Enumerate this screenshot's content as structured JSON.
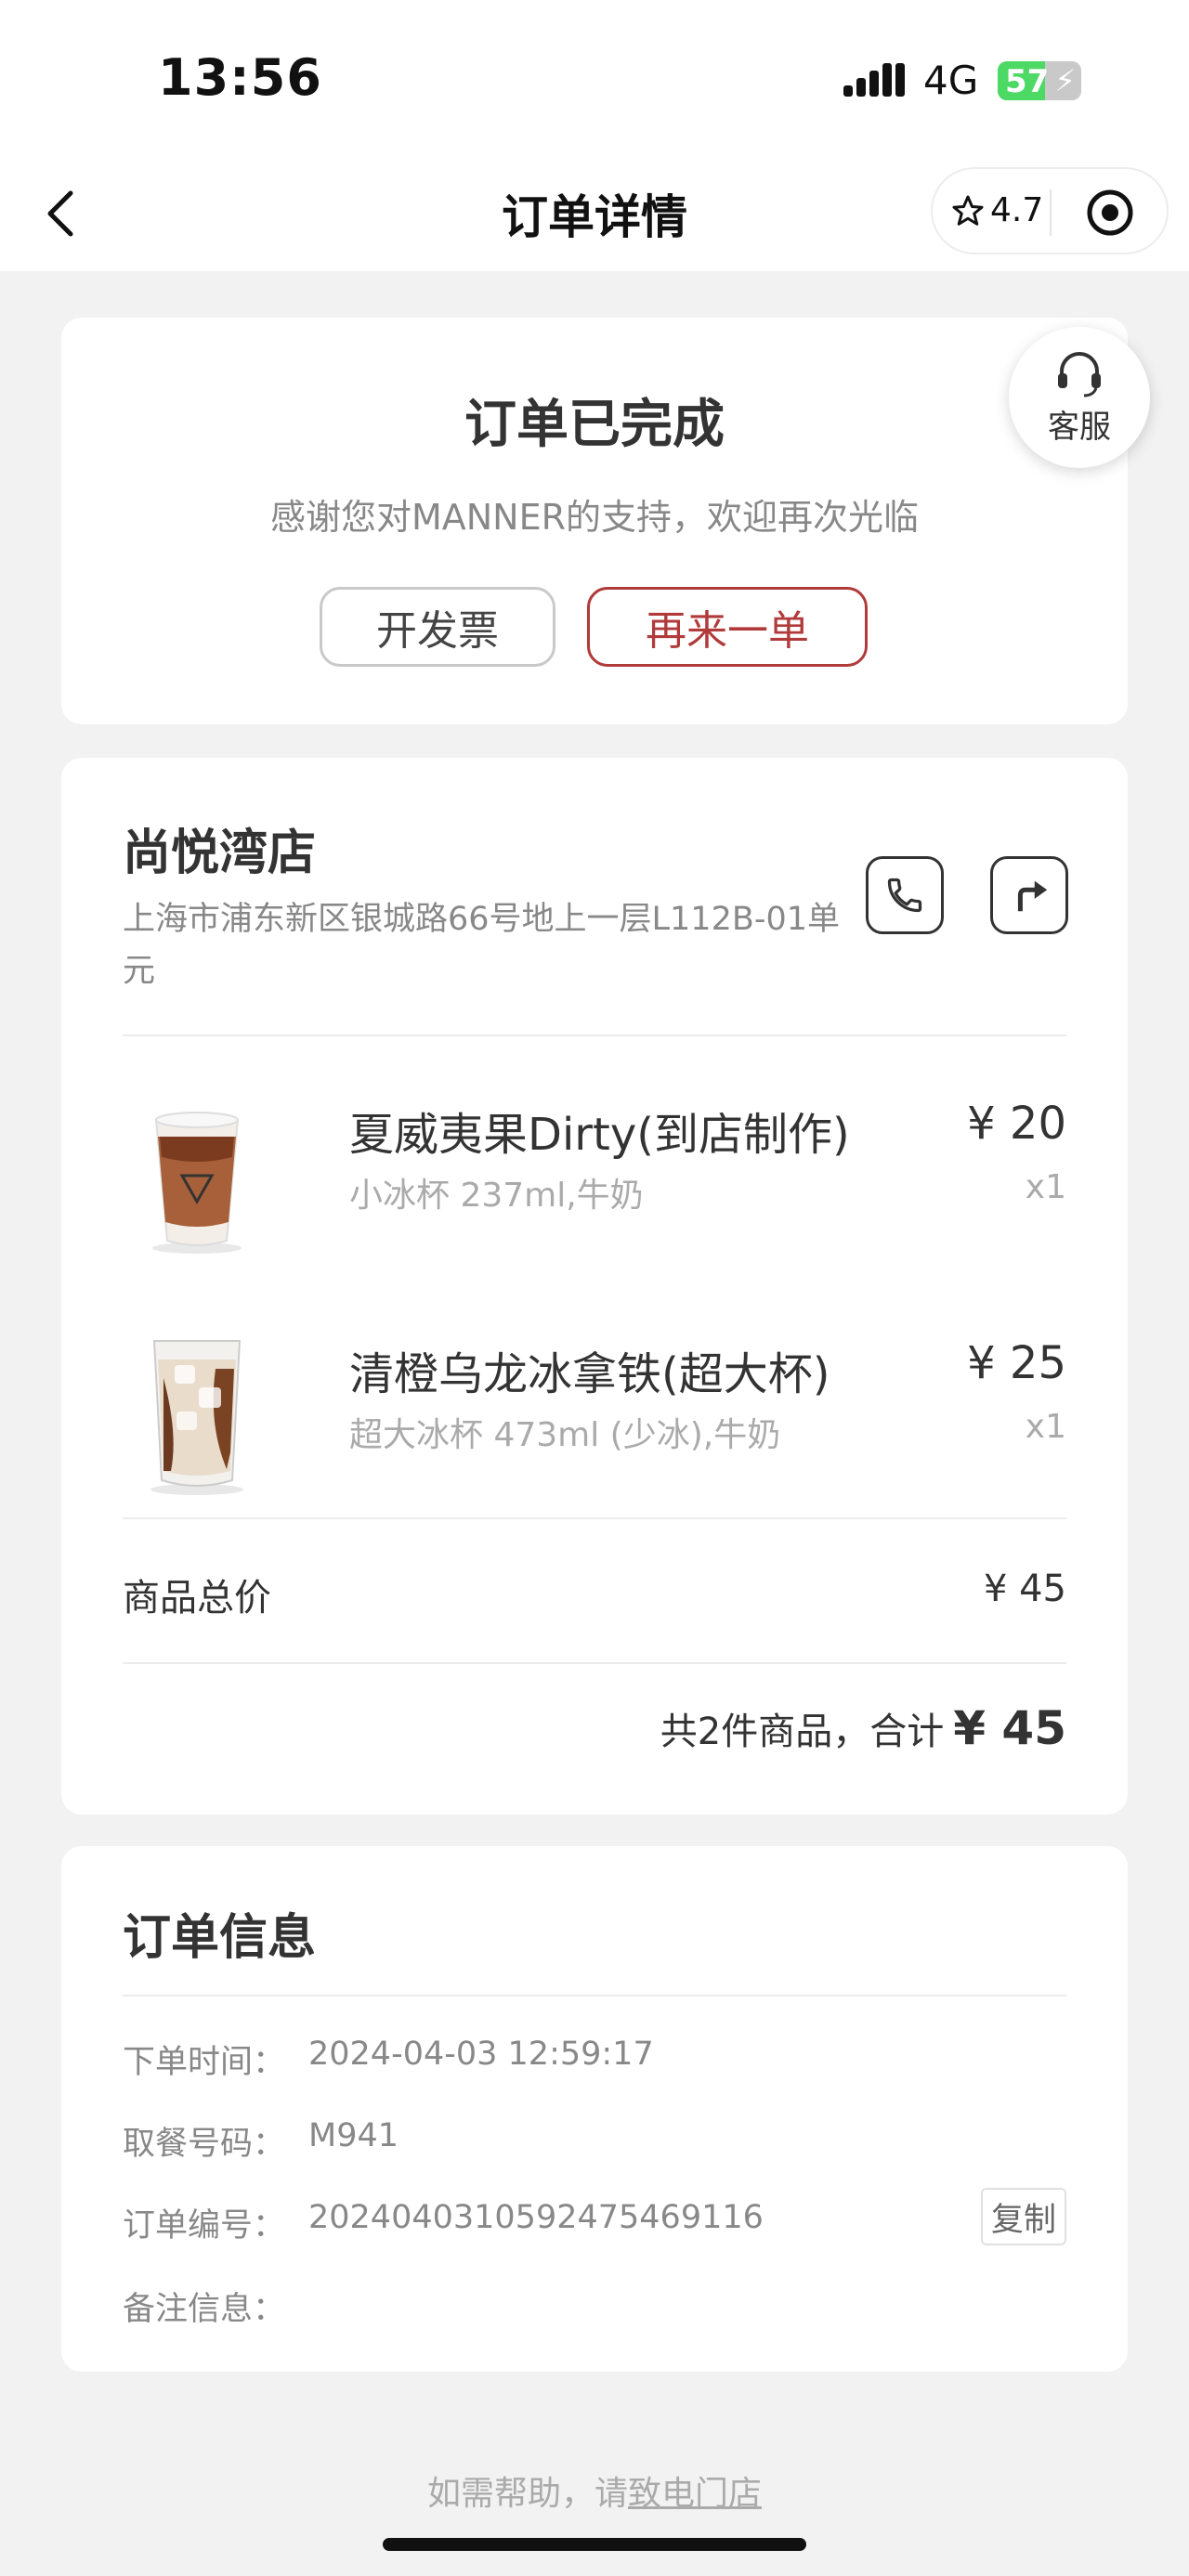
{
  "status_bar": {
    "time": "13:56",
    "network": "4G",
    "battery_level": "57",
    "battery_percent": 57,
    "battery_color": "#4cd964"
  },
  "nav": {
    "title": "订单详情",
    "rating": "4.7",
    "back_icon": "chevron-left-icon",
    "capsule_icon": "target-icon"
  },
  "order_status": {
    "title": "订单已完成",
    "subtitle": "感谢您对MANNER的支持，欢迎再次光临",
    "invoice_label": "开发票",
    "reorder_label": "再来一单",
    "accent_color": "#b13a3a"
  },
  "customer_service": {
    "label": "客服",
    "icon": "headset-icon"
  },
  "store": {
    "name": "尚悦湾店",
    "address": "上海市浦东新区银城路66号地上一层L112B-01单元",
    "phone_icon": "phone-icon",
    "navigate_icon": "navigate-icon"
  },
  "products": [
    {
      "name": "夏威夷果Dirty(到店制作)",
      "spec": "小冰杯 237ml,牛奶",
      "price": "¥ 20",
      "quantity": "x1"
    },
    {
      "name": "清橙乌龙冰拿铁(超大杯)",
      "spec": "超大冰杯 473ml (少冰),牛奶",
      "price": "¥ 25",
      "quantity": "x1"
    }
  ],
  "totals": {
    "label": "商品总价",
    "value": "¥ 45",
    "summary_text": "共2件商品，合计",
    "summary_amount": "¥ 45"
  },
  "order_info": {
    "title": "订单信息",
    "order_time_label": "下单时间：",
    "order_time": "2024-04-03 12:59:17",
    "pickup_label": "取餐号码：",
    "pickup_code": "M941",
    "order_no_label": "订单编号：",
    "order_no": "2024040310592475469116",
    "copy_label": "复制",
    "remark_label": "备注信息："
  },
  "footer": {
    "help_prefix": "如需帮助，请",
    "help_link": "致电门店"
  }
}
